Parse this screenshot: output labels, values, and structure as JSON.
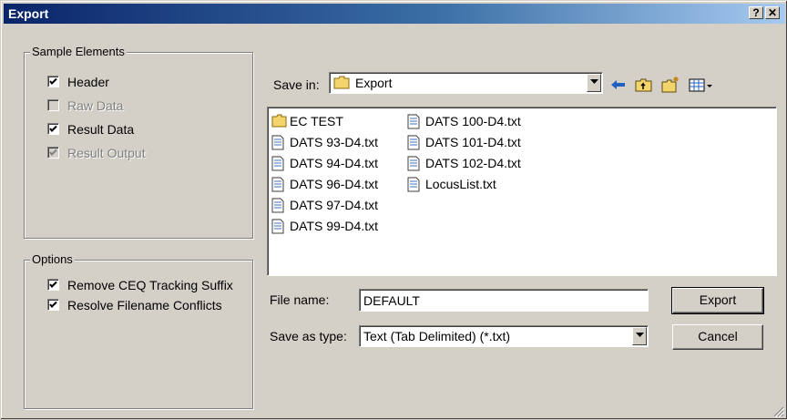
{
  "window": {
    "title": "Export",
    "help_label": "?",
    "close_label": "✕"
  },
  "sample_elements": {
    "title": "Sample Elements",
    "items": [
      {
        "label": "Header",
        "checked": true,
        "enabled": true
      },
      {
        "label": "Raw Data",
        "checked": false,
        "enabled": false
      },
      {
        "label": "Result Data",
        "checked": true,
        "enabled": true
      },
      {
        "label": "Result Output",
        "checked": true,
        "enabled": false
      }
    ]
  },
  "options": {
    "title": "Options",
    "items": [
      {
        "label": "Remove CEQ Tracking Suffix",
        "checked": true
      },
      {
        "label": "Resolve Filename Conflicts",
        "checked": true
      }
    ]
  },
  "save_in": {
    "label": "Save in:",
    "value": "Export",
    "icon": "folder-icon"
  },
  "toolbar": [
    "back-arrow-icon",
    "up-folder-icon",
    "new-folder-icon",
    "view-menu-icon"
  ],
  "files": {
    "column1": [
      {
        "name": "EC TEST",
        "type": "folder"
      },
      {
        "name": "DATS 93-D4.txt",
        "type": "text"
      },
      {
        "name": "DATS 94-D4.txt",
        "type": "text"
      },
      {
        "name": "DATS 96-D4.txt",
        "type": "text"
      },
      {
        "name": "DATS 97-D4.txt",
        "type": "text"
      },
      {
        "name": "DATS 99-D4.txt",
        "type": "text"
      }
    ],
    "column2": [
      {
        "name": "DATS 100-D4.txt",
        "type": "text"
      },
      {
        "name": "DATS 101-D4.txt",
        "type": "text"
      },
      {
        "name": "DATS 102-D4.txt",
        "type": "text"
      },
      {
        "name": "LocusList.txt",
        "type": "text"
      }
    ]
  },
  "file_name": {
    "label": "File name:",
    "value": "DEFAULT"
  },
  "save_as_type": {
    "label": "Save as type:",
    "value": "Text (Tab Delimited) (*.txt)"
  },
  "buttons": {
    "export": "Export",
    "cancel": "Cancel"
  },
  "colors": {
    "face": "#d4d0c8",
    "title_start": "#0a246a",
    "title_end": "#a6caf0",
    "folder": "#f4d56b"
  }
}
